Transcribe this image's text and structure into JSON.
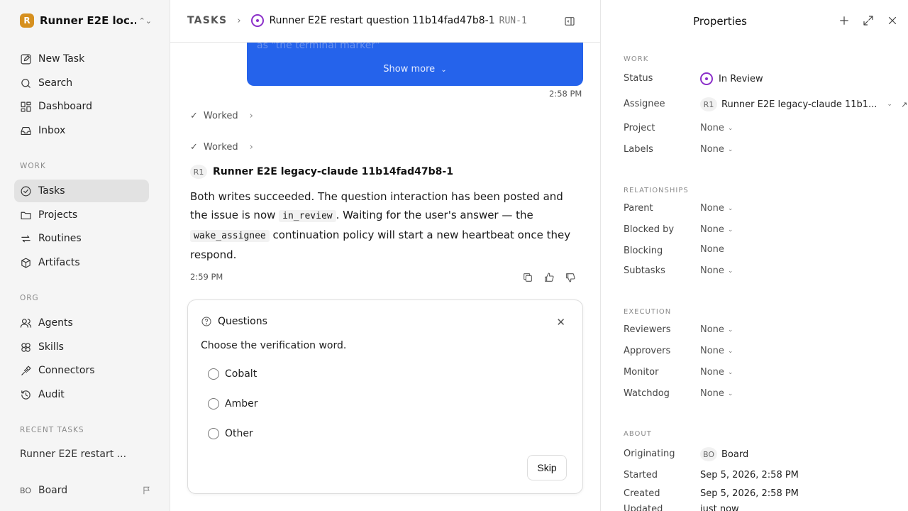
{
  "workspace": {
    "logo": "R",
    "name": "Runner E2E loc..."
  },
  "nav": {
    "new_task": "New Task",
    "search": "Search",
    "dashboard": "Dashboard",
    "inbox": "Inbox"
  },
  "sections": {
    "work": "WORK",
    "org": "ORG",
    "recent": "RECENT TASKS"
  },
  "work_nav": {
    "tasks": "Tasks",
    "projects": "Projects",
    "routines": "Routines",
    "artifacts": "Artifacts"
  },
  "org_nav": {
    "agents": "Agents",
    "skills": "Skills",
    "connectors": "Connectors",
    "audit": "Audit"
  },
  "recent": {
    "item": "Runner E2E restart ..."
  },
  "user": {
    "initials": "BO",
    "name": "Board"
  },
  "breadcrumb": {
    "root": "TASKS",
    "title": "Runner E2E restart question 11b14fad47b8-1",
    "id": "RUN-1"
  },
  "thread": {
    "faded_text": "as \"the terminal marker\"",
    "show_more": "Show more",
    "bubble_time": "2:58 PM",
    "worked_1": "Worked",
    "worked_2": "Worked",
    "agent_initials": "R1",
    "agent_name": "Runner E2E legacy-claude 11b14fad47b8-1",
    "reply_part1": "Both writes succeeded. The question interaction has been posted and the issue is now ",
    "reply_code1": "in_review",
    "reply_part2": ". Waiting for the user's answer — the ",
    "reply_code2": "wake_assignee",
    "reply_part3": " continuation policy will start a new heartbeat once they respond.",
    "reply_time": "2:59 PM"
  },
  "question": {
    "title": "Questions",
    "prompt": "Choose the verification word.",
    "options": [
      "Cobalt",
      "Amber",
      "Other"
    ],
    "skip": "Skip"
  },
  "properties": {
    "title": "Properties",
    "work_label": "WORK",
    "status_label": "Status",
    "status_value": "In Review",
    "assignee_label": "Assignee",
    "assignee_initials": "R1",
    "assignee_value": "Runner E2E legacy-claude 11b1...",
    "project_label": "Project",
    "project_value": "None",
    "labels_label": "Labels",
    "labels_value": "None",
    "relationships_label": "RELATIONSHIPS",
    "parent_label": "Parent",
    "parent_value": "None",
    "blocked_by_label": "Blocked by",
    "blocked_by_value": "None",
    "blocking_label": "Blocking",
    "blocking_value": "None",
    "subtasks_label": "Subtasks",
    "subtasks_value": "None",
    "execution_label": "EXECUTION",
    "reviewers_label": "Reviewers",
    "reviewers_value": "None",
    "approvers_label": "Approvers",
    "approvers_value": "None",
    "monitor_label": "Monitor",
    "monitor_value": "None",
    "watchdog_label": "Watchdog",
    "watchdog_value": "None",
    "about_label": "ABOUT",
    "originating_label": "Originating",
    "originating_initials": "BO",
    "originating_value": "Board",
    "started_label": "Started",
    "started_value": "Sep 5, 2026, 2:58 PM",
    "created_label": "Created",
    "created_value": "Sep 5, 2026, 2:58 PM",
    "updated_label": "Updated",
    "updated_value": "just now"
  },
  "colors": {
    "accent_blue": "#2563eb",
    "status_purple": "#8b2fc9",
    "logo_orange": "#d6901f"
  }
}
